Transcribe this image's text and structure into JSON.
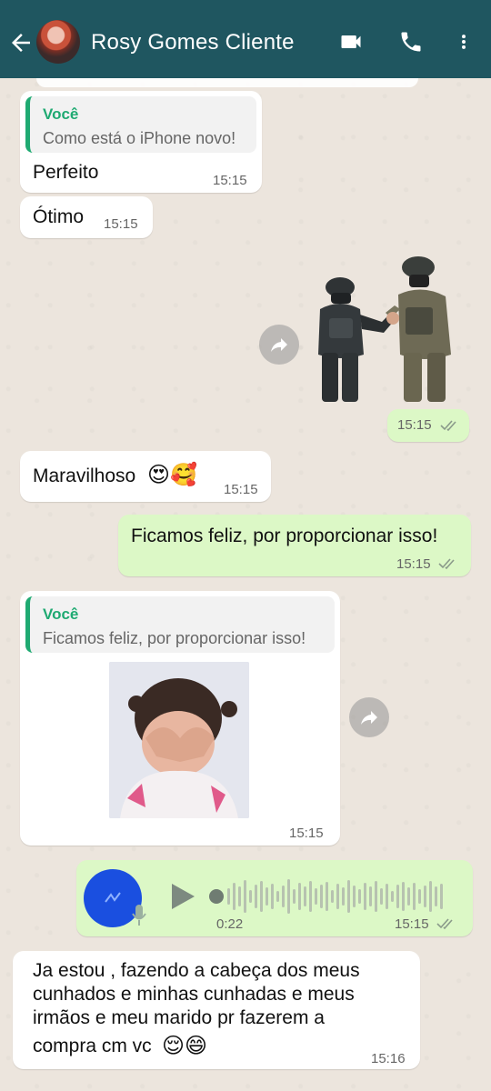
{
  "header": {
    "contact_name": "Rosy Gomes Cliente",
    "icons": [
      "back-arrow-icon",
      "video-call-icon",
      "phone-icon",
      "more-vert-icon"
    ],
    "color": "#1f5660"
  },
  "messages": {
    "m1": {
      "quote_author": "Você",
      "quote_text": "Como está o iPhone novo!",
      "text": "Perfeito",
      "time": "15:15"
    },
    "m2": {
      "text": "Ótimo",
      "time": "15:15"
    },
    "m3": {
      "time": "15:15"
    },
    "m4": {
      "text": "Maravilhoso",
      "emoji": "😍🥰",
      "time": "15:15"
    },
    "m5": {
      "text": "Ficamos feliz, por proporcionar isso!",
      "time": "15:15"
    },
    "m6": {
      "quote_author": "Você",
      "quote_text": "Ficamos feliz, por proporcionar isso!",
      "time": "15:15"
    },
    "m7": {
      "duration": "0:22",
      "time": "15:15"
    },
    "m8": {
      "line1": "Ja estou , fazendo a cabeça dos meus",
      "line2": "cunhados e minhas cunhadas e meus",
      "line3": "irmãos e meu marido pr fazerem a",
      "line4": "compra cm vc",
      "emoji": "😌😄",
      "time": "15:16"
    }
  },
  "colors": {
    "outgoing": "#dcf8c6",
    "incoming": "#ffffff",
    "quote_accent": "#1faa72",
    "read_ticks": "#8a9a8a"
  }
}
